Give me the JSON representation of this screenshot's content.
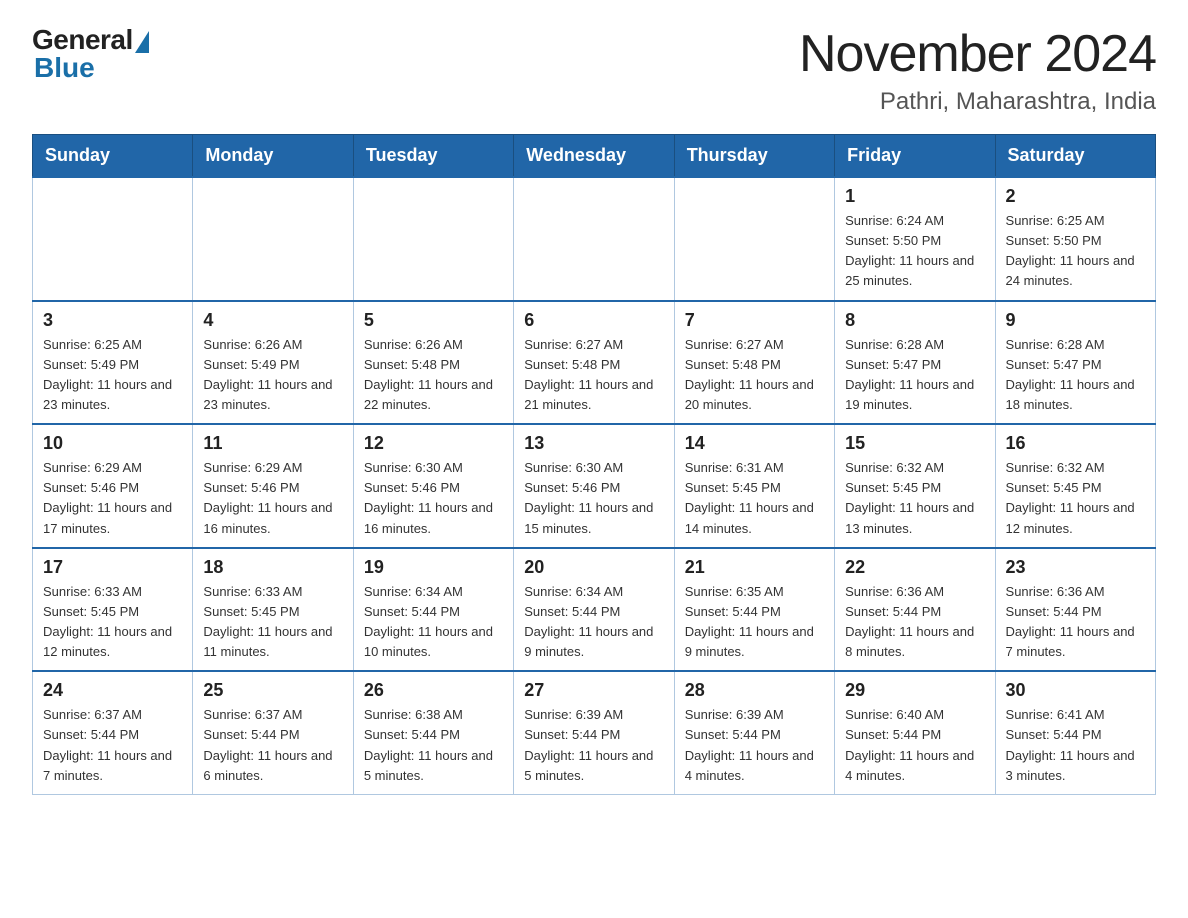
{
  "logo": {
    "general": "General",
    "blue": "Blue"
  },
  "title": "November 2024",
  "subtitle": "Pathri, Maharashtra, India",
  "weekdays": [
    "Sunday",
    "Monday",
    "Tuesday",
    "Wednesday",
    "Thursday",
    "Friday",
    "Saturday"
  ],
  "weeks": [
    [
      {
        "day": "",
        "info": ""
      },
      {
        "day": "",
        "info": ""
      },
      {
        "day": "",
        "info": ""
      },
      {
        "day": "",
        "info": ""
      },
      {
        "day": "",
        "info": ""
      },
      {
        "day": "1",
        "info": "Sunrise: 6:24 AM\nSunset: 5:50 PM\nDaylight: 11 hours and 25 minutes."
      },
      {
        "day": "2",
        "info": "Sunrise: 6:25 AM\nSunset: 5:50 PM\nDaylight: 11 hours and 24 minutes."
      }
    ],
    [
      {
        "day": "3",
        "info": "Sunrise: 6:25 AM\nSunset: 5:49 PM\nDaylight: 11 hours and 23 minutes."
      },
      {
        "day": "4",
        "info": "Sunrise: 6:26 AM\nSunset: 5:49 PM\nDaylight: 11 hours and 23 minutes."
      },
      {
        "day": "5",
        "info": "Sunrise: 6:26 AM\nSunset: 5:48 PM\nDaylight: 11 hours and 22 minutes."
      },
      {
        "day": "6",
        "info": "Sunrise: 6:27 AM\nSunset: 5:48 PM\nDaylight: 11 hours and 21 minutes."
      },
      {
        "day": "7",
        "info": "Sunrise: 6:27 AM\nSunset: 5:48 PM\nDaylight: 11 hours and 20 minutes."
      },
      {
        "day": "8",
        "info": "Sunrise: 6:28 AM\nSunset: 5:47 PM\nDaylight: 11 hours and 19 minutes."
      },
      {
        "day": "9",
        "info": "Sunrise: 6:28 AM\nSunset: 5:47 PM\nDaylight: 11 hours and 18 minutes."
      }
    ],
    [
      {
        "day": "10",
        "info": "Sunrise: 6:29 AM\nSunset: 5:46 PM\nDaylight: 11 hours and 17 minutes."
      },
      {
        "day": "11",
        "info": "Sunrise: 6:29 AM\nSunset: 5:46 PM\nDaylight: 11 hours and 16 minutes."
      },
      {
        "day": "12",
        "info": "Sunrise: 6:30 AM\nSunset: 5:46 PM\nDaylight: 11 hours and 16 minutes."
      },
      {
        "day": "13",
        "info": "Sunrise: 6:30 AM\nSunset: 5:46 PM\nDaylight: 11 hours and 15 minutes."
      },
      {
        "day": "14",
        "info": "Sunrise: 6:31 AM\nSunset: 5:45 PM\nDaylight: 11 hours and 14 minutes."
      },
      {
        "day": "15",
        "info": "Sunrise: 6:32 AM\nSunset: 5:45 PM\nDaylight: 11 hours and 13 minutes."
      },
      {
        "day": "16",
        "info": "Sunrise: 6:32 AM\nSunset: 5:45 PM\nDaylight: 11 hours and 12 minutes."
      }
    ],
    [
      {
        "day": "17",
        "info": "Sunrise: 6:33 AM\nSunset: 5:45 PM\nDaylight: 11 hours and 12 minutes."
      },
      {
        "day": "18",
        "info": "Sunrise: 6:33 AM\nSunset: 5:45 PM\nDaylight: 11 hours and 11 minutes."
      },
      {
        "day": "19",
        "info": "Sunrise: 6:34 AM\nSunset: 5:44 PM\nDaylight: 11 hours and 10 minutes."
      },
      {
        "day": "20",
        "info": "Sunrise: 6:34 AM\nSunset: 5:44 PM\nDaylight: 11 hours and 9 minutes."
      },
      {
        "day": "21",
        "info": "Sunrise: 6:35 AM\nSunset: 5:44 PM\nDaylight: 11 hours and 9 minutes."
      },
      {
        "day": "22",
        "info": "Sunrise: 6:36 AM\nSunset: 5:44 PM\nDaylight: 11 hours and 8 minutes."
      },
      {
        "day": "23",
        "info": "Sunrise: 6:36 AM\nSunset: 5:44 PM\nDaylight: 11 hours and 7 minutes."
      }
    ],
    [
      {
        "day": "24",
        "info": "Sunrise: 6:37 AM\nSunset: 5:44 PM\nDaylight: 11 hours and 7 minutes."
      },
      {
        "day": "25",
        "info": "Sunrise: 6:37 AM\nSunset: 5:44 PM\nDaylight: 11 hours and 6 minutes."
      },
      {
        "day": "26",
        "info": "Sunrise: 6:38 AM\nSunset: 5:44 PM\nDaylight: 11 hours and 5 minutes."
      },
      {
        "day": "27",
        "info": "Sunrise: 6:39 AM\nSunset: 5:44 PM\nDaylight: 11 hours and 5 minutes."
      },
      {
        "day": "28",
        "info": "Sunrise: 6:39 AM\nSunset: 5:44 PM\nDaylight: 11 hours and 4 minutes."
      },
      {
        "day": "29",
        "info": "Sunrise: 6:40 AM\nSunset: 5:44 PM\nDaylight: 11 hours and 4 minutes."
      },
      {
        "day": "30",
        "info": "Sunrise: 6:41 AM\nSunset: 5:44 PM\nDaylight: 11 hours and 3 minutes."
      }
    ]
  ]
}
